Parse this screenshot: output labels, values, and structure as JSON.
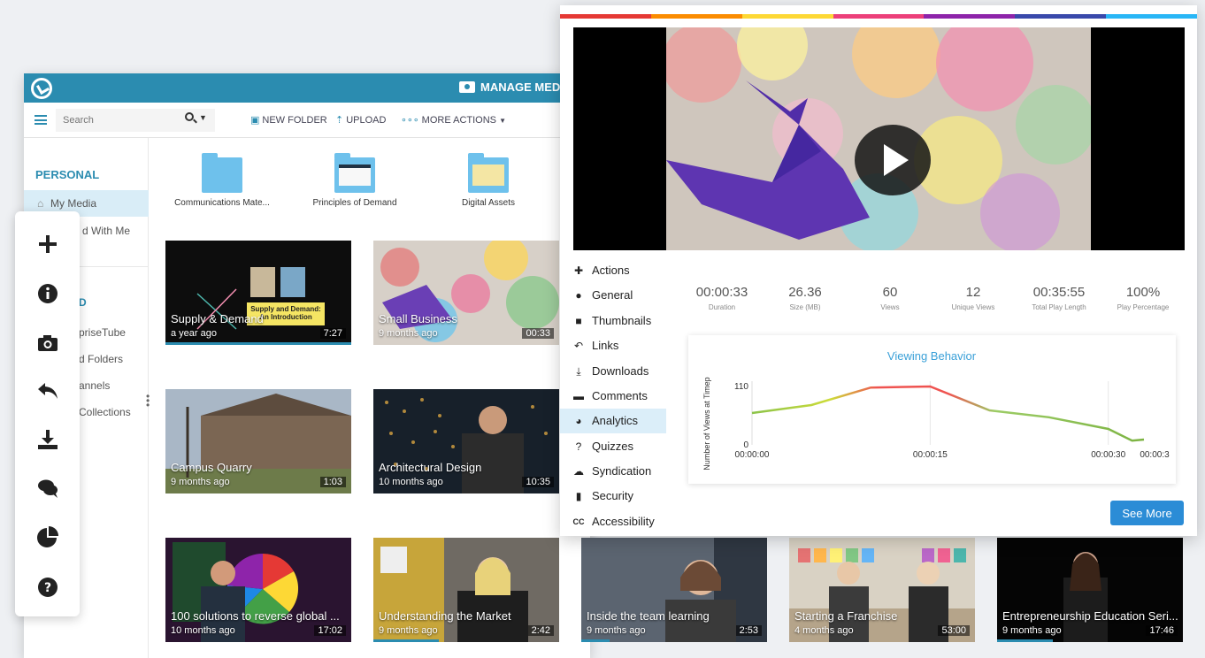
{
  "app": {
    "manage_title": "MANAGE MEDI",
    "search_placeholder": "Search",
    "toolbar": {
      "new_folder": "NEW FOLDER",
      "upload": "UPLOAD",
      "more_actions": "MORE ACTIONS"
    }
  },
  "sidebar": {
    "heading": "PERSONAL",
    "items": [
      {
        "label": "My Media",
        "active": true
      },
      {
        "label": "d With Me"
      },
      {
        "label": "D"
      },
      {
        "label": "priseTube"
      },
      {
        "label": "d Folders"
      },
      {
        "label": "annels"
      },
      {
        "label": "Collections"
      }
    ]
  },
  "folders": [
    {
      "label": "Communications Mate..."
    },
    {
      "label": "Principles of Demand"
    },
    {
      "label": "Digital Assets"
    }
  ],
  "thumbnails": [
    {
      "title": "Supply & Demand",
      "age": "a year ago",
      "duration": "7:27",
      "progress": 1.0,
      "overlay": "Supply and Demand:",
      "overlay2": "An Introduction"
    },
    {
      "title": "Small Business",
      "age": "9 months ago",
      "duration": "00:33",
      "progress": 0
    },
    {
      "title": "Campus Quarry",
      "age": "9 months ago",
      "duration": "1:03",
      "progress": 0
    },
    {
      "title": "Architectural Design",
      "age": "10 months ago",
      "duration": "10:35",
      "progress": 0
    },
    {
      "title": "100 solutions to reverse global ...",
      "age": "10 months ago",
      "duration": "17:02",
      "progress": 0
    },
    {
      "title": "Understanding the Market",
      "age": "9 months ago",
      "duration": "2:42",
      "progress": 0.35
    },
    {
      "title": "Inside the team learning",
      "age": "9 months ago",
      "duration": "2:53",
      "progress": 0.15
    },
    {
      "title": "Starting a Franchise",
      "age": "4 months ago",
      "duration": "53:00",
      "progress": 0
    },
    {
      "title": "Entrepreneurship Education Seri...",
      "age": "9 months ago",
      "duration": "17:46",
      "progress": 0.3
    }
  ],
  "float_icons": [
    "plus-icon",
    "info-icon",
    "camera-icon",
    "reply-icon",
    "download-icon",
    "comments-icon",
    "pie-chart-icon",
    "question-icon"
  ],
  "detail": {
    "menu": [
      {
        "label": "Actions",
        "icon": "plus-icon"
      },
      {
        "label": "General",
        "icon": "info-icon"
      },
      {
        "label": "Thumbnails",
        "icon": "camera-icon"
      },
      {
        "label": "Links",
        "icon": "reply-icon"
      },
      {
        "label": "Downloads",
        "icon": "download-icon"
      },
      {
        "label": "Comments",
        "icon": "comments-icon"
      },
      {
        "label": "Analytics",
        "icon": "pie-chart-icon",
        "active": true
      },
      {
        "label": "Quizzes",
        "icon": "question-icon"
      },
      {
        "label": "Syndication",
        "icon": "cloud-upload-icon"
      },
      {
        "label": "Security",
        "icon": "lock-icon"
      },
      {
        "label": "Accessibility",
        "icon": "closed-captions-icon"
      }
    ],
    "stats": [
      {
        "value": "00:00:33",
        "label": "Duration"
      },
      {
        "value": "26.36",
        "label": "Size (MB)"
      },
      {
        "value": "60",
        "label": "Views"
      },
      {
        "value": "12",
        "label": "Unique Views"
      },
      {
        "value": "00:35:55",
        "label": "Total Play Length"
      },
      {
        "value": "100%",
        "label": "Play Percentage"
      }
    ],
    "see_more": "See More",
    "stripe_colors": [
      "#e53935",
      "#fb8c00",
      "#fdd835",
      "#ec407a",
      "#8e24aa",
      "#3949ab",
      "#29b6f6"
    ]
  },
  "chart_data": {
    "type": "line",
    "title": "Viewing Behavior",
    "ylabel": "Number of Views at Timep",
    "xlabel": "",
    "x_tick_labels": [
      "00:00:00",
      "00:00:15",
      "00:00:30",
      "00:00:3"
    ],
    "y_tick_labels": [
      "110",
      "0"
    ],
    "ylim": [
      0,
      110
    ],
    "xlim": [
      0,
      33
    ],
    "x": [
      0,
      5,
      10,
      15,
      20,
      25,
      30,
      32,
      33
    ],
    "values": [
      60,
      75,
      108,
      110,
      65,
      52,
      30,
      8,
      10
    ],
    "colors": {
      "low": "#8bc34a",
      "mid": "#fbc02d",
      "high": "#ef5350"
    },
    "title_color": "#3aa0d8"
  }
}
